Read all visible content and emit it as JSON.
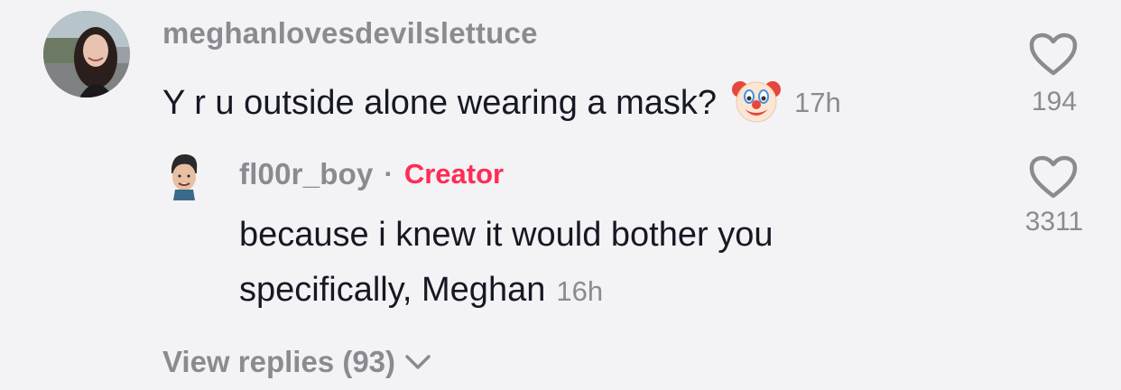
{
  "comment": {
    "username": "meghanlovesdevilslettuce",
    "text": "Y r u outside alone wearing a mask?",
    "emoji_icon": "clown-face-icon",
    "timestamp": "17h",
    "like_count": "194"
  },
  "reply": {
    "username": "fl00r_boy",
    "separator": "·",
    "badge": "Creator",
    "text_line1": "because i knew it would bother you",
    "text_line2": "specifically, Meghan",
    "timestamp": "16h",
    "like_count": "3311"
  },
  "view_replies": {
    "label": "View replies (93)",
    "icon": "chevron-down-icon"
  },
  "colors": {
    "background": "#f3f2f5",
    "primary_text": "#161823",
    "secondary_text": "#8a8b91",
    "creator_accent": "#fe2c55"
  }
}
